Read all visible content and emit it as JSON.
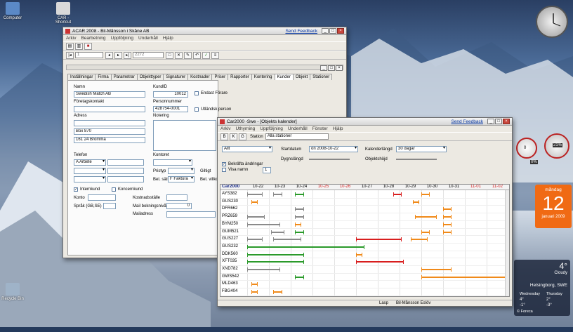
{
  "desktop": {
    "icons": [
      {
        "label": "Computer",
        "glyph": "computer-icon"
      },
      {
        "label": "CAR - Shortcut",
        "glyph": "shortcut-icon"
      },
      {
        "label": "Recycle Bin",
        "glyph": "recycle-bin-icon"
      }
    ]
  },
  "acar": {
    "title": "ACAR 2008 - Bil-Månsson i Skåne AB",
    "feedback": "Send Feedback",
    "menu": [
      "Arkiv",
      "Bearbetning",
      "Uppföljning",
      "Underhåll",
      "Hjälp"
    ],
    "record_field": "1",
    "record_count": "2272",
    "tabs": [
      "Inställningar",
      "Firma",
      "Parametrar",
      "Objekttyper",
      "Signaturer",
      "Kostnader",
      "Priser",
      "Rapporter",
      "Kontering",
      "Kunder",
      "Objekt",
      "Stationer"
    ],
    "active_tab": "Kunder",
    "form": {
      "namn_label": "Namn",
      "namn_value": "Swedish Match AB",
      "kundid_label": "KundID",
      "kundid_value": "10012",
      "endast_forare": "Endast Förare",
      "foretagskontakt_label": "Företagskontakt",
      "personnummer_label": "Personnummer",
      "personnummer_value": "428754-0001",
      "utlandsk_person": "Utländsk person",
      "adress_label": "Adress",
      "adress_line2": "Box 870",
      "adress_line3": "161 24 Bromma",
      "notering_label": "Notering",
      "telefon_label": "Telefon",
      "telefon_type": "A Arbete",
      "kontoret_label": "Kontoret",
      "pristyp_label": "Pristyp",
      "giltigt_label": "Giltigt",
      "bet_satt_label": "Bet. sätt",
      "bet_satt_value": "F Faktura",
      "bet_villkor_label": "Bet. villkor",
      "internkund": "Internkund",
      "koncernkund": "Koncernkund",
      "konto_label": "Konto",
      "kostnadsstalle_label": "Kostnadsställe",
      "sprak_label": "Språk (GB,SE)",
      "mail_label": "Mail bokningsnivå",
      "mail_value": "0",
      "mailadress_label": "Mailadress"
    }
  },
  "car2000": {
    "title": "Car2000 -Swe - [Objekts kalender]",
    "feedback": "Send Feedback",
    "menu": [
      "Arkiv",
      "Uthyrning",
      "Uppföljning",
      "Underhåll",
      "Fönster",
      "Hjälp"
    ],
    "toolbar_station_label": "Station",
    "station_value": "Alla stationer",
    "filter_value": "Allt",
    "startdatum_label": "Startdatum",
    "startdatum_value": "on 2008-10-22",
    "kalenderlangd_label": "Kalenderlängd",
    "kalenderlangd_value": "30 dagar",
    "dygnslangd_label": "Dygnslängd",
    "objektshojd_label": "Objektshöjd",
    "bekrafta_label": "Bekräfta ändringar",
    "visa_namn_label": "Visa namn",
    "visa_namn_value": "1",
    "status_left": "Lasp",
    "status_right": "Bil-Månsson Eslöv",
    "colors": {
      "green": "#2a9a2a",
      "orange": "#f08a1a",
      "red": "#d81e1e",
      "grey": "#8a8a8a",
      "weekend": "#d81e1e"
    }
  },
  "chart_data": {
    "type": "table",
    "corner_label": "Car2000",
    "dates": [
      "10-22",
      "10-23",
      "10-24",
      "10-25",
      "10-26",
      "10-27",
      "10-28",
      "10-29",
      "10-30",
      "10-31",
      "11-01",
      "11-02"
    ],
    "weekend_dates": [
      "10-25",
      "10-26",
      "11-01",
      "11-02"
    ],
    "rows": [
      {
        "id": "AYS382",
        "bookings": [
          {
            "start": 0.0,
            "end": 0.7,
            "color": "grey"
          },
          {
            "start": 1.2,
            "end": 1.6,
            "color": "grey"
          },
          {
            "start": 2.2,
            "end": 2.6,
            "color": "green"
          },
          {
            "start": 6.7,
            "end": 7.1,
            "color": "red"
          },
          {
            "start": 8.0,
            "end": 8.4,
            "color": "orange"
          }
        ]
      },
      {
        "id": "GUS230",
        "bookings": [
          {
            "start": 0.2,
            "end": 0.5,
            "color": "orange"
          },
          {
            "start": 7.6,
            "end": 7.9,
            "color": "orange"
          }
        ]
      },
      {
        "id": "DFR662",
        "bookings": [
          {
            "start": 2.2,
            "end": 2.6,
            "color": "grey"
          },
          {
            "start": 9.0,
            "end": 9.4,
            "color": "orange"
          }
        ]
      },
      {
        "id": "PRZ659",
        "bookings": [
          {
            "start": 0.0,
            "end": 0.8,
            "color": "grey"
          },
          {
            "start": 2.2,
            "end": 2.6,
            "color": "grey"
          },
          {
            "start": 7.7,
            "end": 8.7,
            "color": "orange"
          },
          {
            "start": 9.0,
            "end": 9.4,
            "color": "orange"
          }
        ]
      },
      {
        "id": "BYM250",
        "bookings": [
          {
            "start": 0.0,
            "end": 1.5,
            "color": "grey"
          },
          {
            "start": 2.2,
            "end": 2.5,
            "color": "orange"
          },
          {
            "start": 9.0,
            "end": 9.4,
            "color": "orange"
          }
        ]
      },
      {
        "id": "GUM521",
        "bookings": [
          {
            "start": 1.1,
            "end": 1.7,
            "color": "grey"
          },
          {
            "start": 2.2,
            "end": 2.6,
            "color": "green"
          },
          {
            "start": 8.0,
            "end": 8.4,
            "color": "orange"
          },
          {
            "start": 9.0,
            "end": 9.4,
            "color": "orange"
          }
        ]
      },
      {
        "id": "GUS227",
        "bookings": [
          {
            "start": 0.0,
            "end": 0.7,
            "color": "grey"
          },
          {
            "start": 1.2,
            "end": 2.5,
            "color": "grey"
          },
          {
            "start": 5.0,
            "end": 7.1,
            "color": "red"
          },
          {
            "start": 7.5,
            "end": 8.3,
            "color": "orange"
          }
        ]
      },
      {
        "id": "GUS232",
        "bookings": [
          {
            "start": 0.0,
            "end": 5.4,
            "color": "green"
          }
        ]
      },
      {
        "id": "DDK560",
        "bookings": [
          {
            "start": 0.0,
            "end": 2.6,
            "color": "green"
          },
          {
            "start": 5.0,
            "end": 5.3,
            "color": "orange"
          }
        ]
      },
      {
        "id": "XFT035",
        "bookings": [
          {
            "start": 0.0,
            "end": 2.6,
            "color": "green"
          },
          {
            "start": 5.0,
            "end": 7.2,
            "color": "red"
          }
        ]
      },
      {
        "id": "XND782",
        "bookings": [
          {
            "start": 0.0,
            "end": 1.5,
            "color": "grey"
          },
          {
            "start": 8.0,
            "end": 9.4,
            "color": "orange"
          }
        ]
      },
      {
        "id": "GWS542",
        "bookings": [
          {
            "start": 2.2,
            "end": 2.6,
            "color": "green"
          },
          {
            "start": 8.0,
            "end": 11.9,
            "color": "orange"
          }
        ]
      },
      {
        "id": "MLD463",
        "bookings": [
          {
            "start": 0.2,
            "end": 0.5,
            "color": "orange"
          }
        ]
      },
      {
        "id": "FBG404",
        "bookings": [
          {
            "start": 0.2,
            "end": 0.5,
            "color": "orange"
          },
          {
            "start": 1.2,
            "end": 1.6,
            "color": "orange"
          }
        ]
      }
    ]
  },
  "gadgets": {
    "calendar_weekday": "måndag",
    "calendar_day": "12",
    "calendar_month": "januari 2009",
    "weather_temp": "4°",
    "weather_desc": "Cloudy",
    "weather_place": "Helsingborg, SWE",
    "weather_days": [
      "Wednesday",
      "Thursday"
    ],
    "weather_hi": [
      "4°",
      "2°"
    ],
    "weather_lo": [
      "-1°",
      "-3°"
    ],
    "weather_brand": "© Foreca",
    "meter_values": [
      "0",
      "21%",
      "0%"
    ]
  }
}
